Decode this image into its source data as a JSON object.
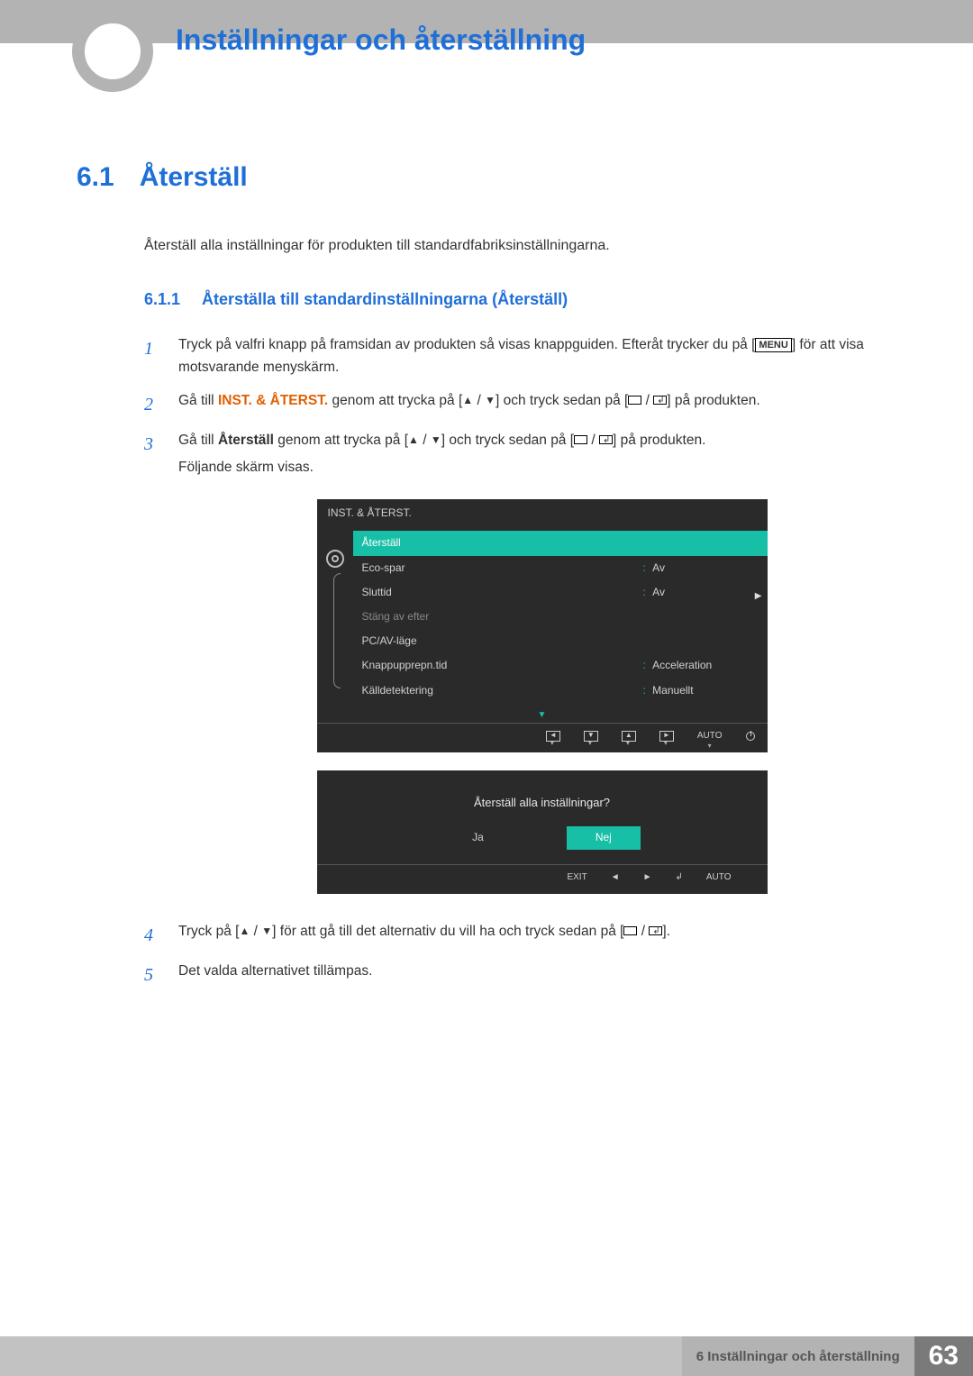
{
  "header": {
    "chapter_title": "Inställningar och återställning"
  },
  "section": {
    "num": "6.1",
    "title": "Återställ",
    "intro": "Återställ alla inställningar för produkten till standardfabriksinställningarna."
  },
  "subsection": {
    "num": "6.1.1",
    "title": "Återställa till standardinställningarna (Återställ)"
  },
  "steps": {
    "s1_a": "Tryck på valfri knapp på framsidan av produkten så visas knappguiden. Efteråt trycker du på [",
    "s1_b": "] för att visa motsvarande menyskärm.",
    "s2_a": "Gå till ",
    "s2_kw": "INST. & ÅTERST.",
    "s2_b": " genom att trycka på [",
    "s2_c": "] och tryck sedan på [",
    "s2_d": "] på produkten.",
    "s3_a": "Gå till ",
    "s3_kw": "Återställ",
    "s3_b": " genom att trycka på [",
    "s3_c": "] och tryck sedan på [",
    "s3_d": "] på produkten.",
    "s3_e": "Följande skärm visas.",
    "s4_a": "Tryck på [",
    "s4_b": "] för att gå till det alternativ du vill ha och tryck sedan på [",
    "s4_c": "].",
    "s5": "Det valda alternativet tillämpas."
  },
  "keys": {
    "menu": "MENU"
  },
  "osd": {
    "title": "INST. & ÅTERST.",
    "items": [
      {
        "label": "Återställ",
        "value": "",
        "selected": true
      },
      {
        "label": "Eco-spar",
        "value": "Av"
      },
      {
        "label": "Sluttid",
        "value": "Av"
      },
      {
        "label": "Stäng av efter",
        "value": "",
        "dim": true
      },
      {
        "label": "PC/AV-läge",
        "value": ""
      },
      {
        "label": "Knappupprepn.tid",
        "value": "Acceleration"
      },
      {
        "label": "Källdetektering",
        "value": "Manuellt"
      }
    ],
    "footer_auto": "AUTO"
  },
  "osd_confirm": {
    "question": "Återställ alla inställningar?",
    "yes": "Ja",
    "no": "Nej",
    "exit": "EXIT",
    "auto": "AUTO"
  },
  "footer": {
    "chapter_label": "6 Inställningar och återställning",
    "page_number": "63"
  }
}
